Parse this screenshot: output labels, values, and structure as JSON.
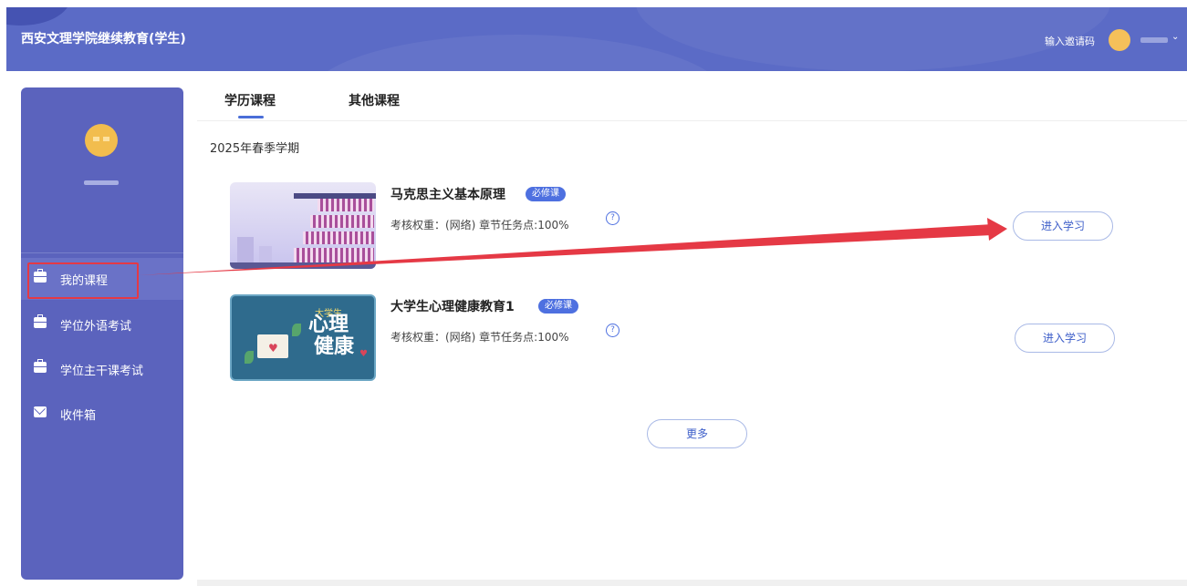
{
  "header": {
    "app_title": "西安文理学院继续教育(学生)",
    "invite_label": "输入邀请码"
  },
  "sidebar": {
    "items": [
      {
        "label": "我的课程",
        "icon": "briefcase-icon"
      },
      {
        "label": "学位外语考试",
        "icon": "briefcase-icon"
      },
      {
        "label": "学位主干课考试",
        "icon": "briefcase-icon"
      },
      {
        "label": "收件箱",
        "icon": "mail-icon"
      }
    ],
    "active_index": 0
  },
  "tabs": [
    {
      "label": "学历课程",
      "active": true
    },
    {
      "label": "其他课程",
      "active": false
    }
  ],
  "semester": "2025年春季学期",
  "courses": [
    {
      "name": "马克思主义基本原理",
      "badge": "必修课",
      "meta": "考核权重：(网络) 章节任务点:100%",
      "button": "进入学习"
    },
    {
      "name": "大学生心理健康教育1",
      "badge": "必修课",
      "meta": "考核权重：(网络) 章节任务点:100%",
      "button": "进入学习",
      "thumb_title_line1": "心理",
      "thumb_title_line2": "健康",
      "thumb_tag": "大学生"
    }
  ],
  "more_button": "更多",
  "help_symbol": "?",
  "colors": {
    "header_bg": "#5b6bc6",
    "sidebar_bg": "#5b63bd",
    "accent": "#4e70e0",
    "annotation_red": "#e53945"
  }
}
